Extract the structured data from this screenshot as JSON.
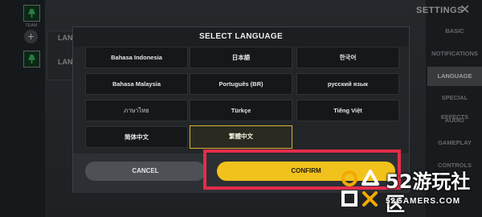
{
  "background": {
    "team_label": "TEAM",
    "add_symbol": "+",
    "panel_text_1": "LANG",
    "panel_text_2": "LANG",
    "settings_title": "SETTINGS",
    "close_symbol": "✕",
    "sidebar": [
      {
        "label": "BASIC",
        "active": false
      },
      {
        "label": "NOTIFICATIONS",
        "active": false
      },
      {
        "label": "LANGUAGE",
        "active": true
      },
      {
        "label": "SPECIAL EFFECTS",
        "active": false
      },
      {
        "label": "AUDIO",
        "active": false
      },
      {
        "label": "GAMEPLAY",
        "active": false
      },
      {
        "label": "CONTROLS",
        "active": false
      }
    ]
  },
  "dialog": {
    "title": "SELECT LANGUAGE",
    "languages": [
      {
        "label": "Bahasa Indonesia",
        "selected": false
      },
      {
        "label": "日本語",
        "selected": false
      },
      {
        "label": "한국어",
        "selected": false
      },
      {
        "label": "Bahasa Malaysia",
        "selected": false
      },
      {
        "label": "Português (BR)",
        "selected": false
      },
      {
        "label": "русский язык",
        "selected": false
      },
      {
        "label": "ภาษาไทย",
        "selected": false
      },
      {
        "label": "Türkçe",
        "selected": false
      },
      {
        "label": "Tiếng Việt",
        "selected": false
      },
      {
        "label": "简体中文",
        "selected": false
      },
      {
        "label": "繁體中文",
        "selected": true
      }
    ],
    "cancel_label": "CANCEL",
    "confirm_label": "CONFIRM"
  },
  "watermark": {
    "title": "52游玩社区",
    "subtitle": "52GAMERS.COM"
  },
  "colors": {
    "accent": "#f2c21c",
    "highlight_border": "#e22d4a",
    "selected_border": "#d7b133"
  }
}
